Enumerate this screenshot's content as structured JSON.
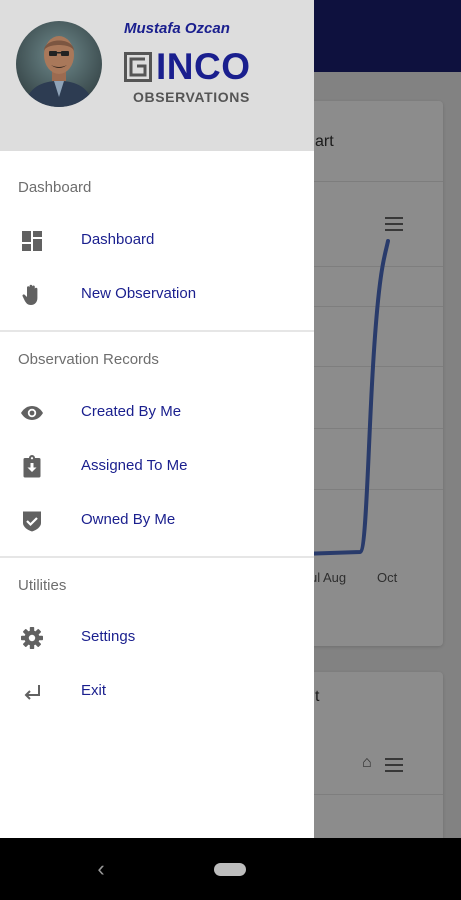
{
  "background": {
    "card1_title_fragment": "art",
    "card2_title_fragment": "t",
    "x_labels": [
      "ul Aug",
      "Oct"
    ]
  },
  "drawer": {
    "user_name": "Mustafa Ozcan",
    "logo_text": "INCO",
    "logo_subtitle": "OBSERVATIONS",
    "sections": [
      {
        "label": "Dashboard",
        "items": [
          {
            "label": "Dashboard",
            "icon": "dashboard-icon"
          },
          {
            "label": "New Observation",
            "icon": "hand-icon"
          }
        ]
      },
      {
        "label": "Observation Records",
        "items": [
          {
            "label": "Created By Me",
            "icon": "eye-icon"
          },
          {
            "label": "Assigned To Me",
            "icon": "clipboard-download-icon"
          },
          {
            "label": "Owned By Me",
            "icon": "shield-check-icon"
          }
        ]
      },
      {
        "label": "Utilities",
        "items": [
          {
            "label": "Settings",
            "icon": "gear-icon"
          },
          {
            "label": "Exit",
            "icon": "return-arrow-icon"
          }
        ]
      }
    ]
  },
  "system_nav": {
    "back_glyph": "‹"
  },
  "colors": {
    "brand": "#1a1f8e",
    "header_bg": "#1a1f71",
    "chart_line": "#4c6cc4"
  }
}
